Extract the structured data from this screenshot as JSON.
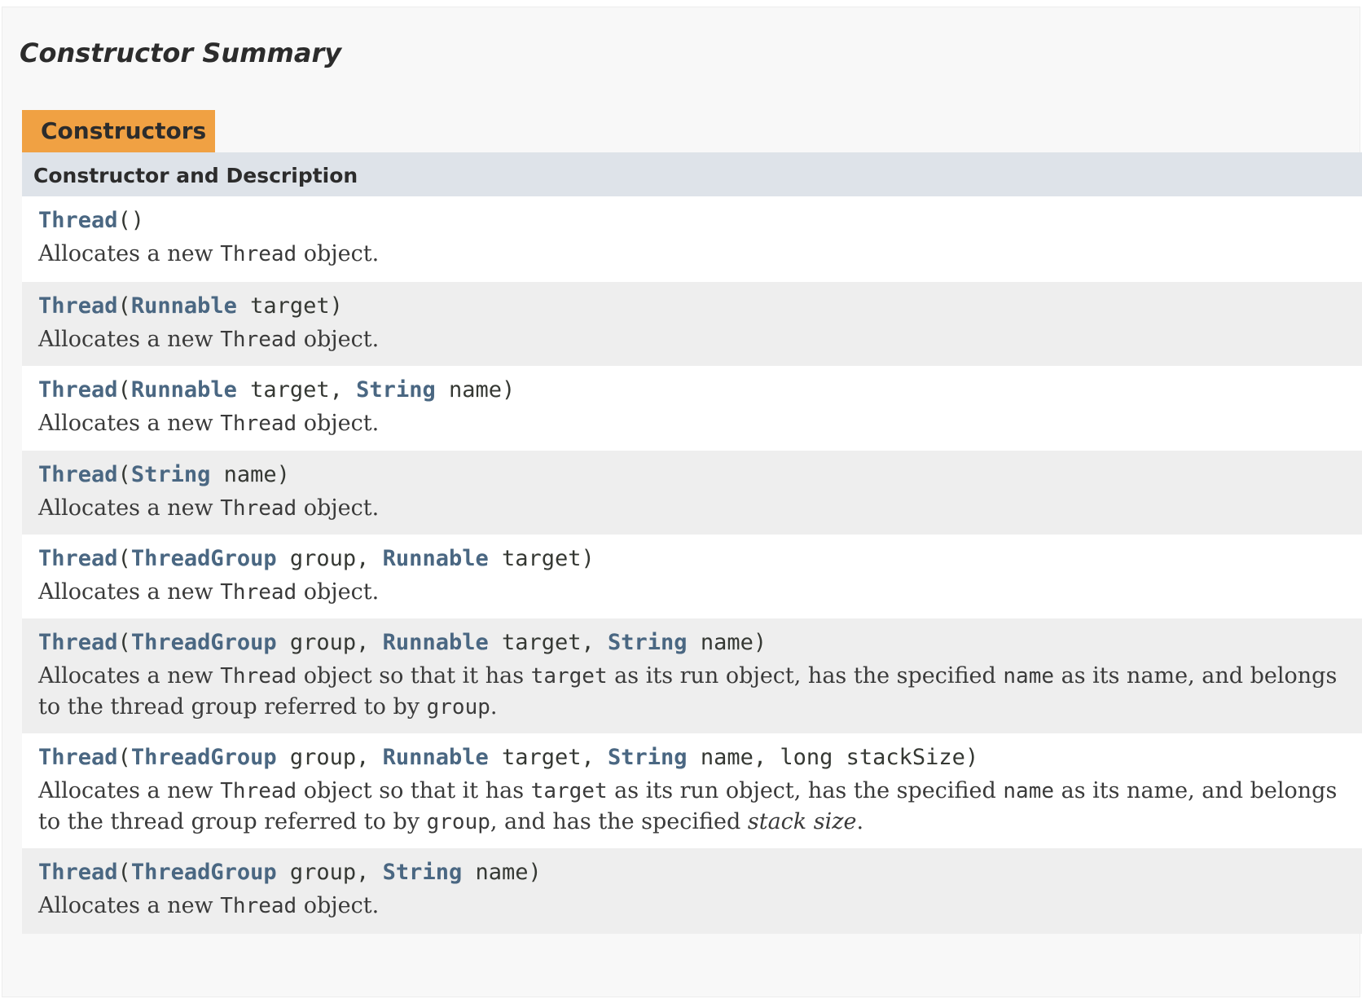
{
  "section": {
    "title": "Constructor Summary",
    "caption": "Constructors",
    "column_header": "Constructor and Description"
  },
  "constructors": [
    {
      "signature": [
        {
          "link": "Thread"
        },
        {
          "text": "()"
        }
      ],
      "description": [
        {
          "text": "Allocates a new "
        },
        {
          "code": "Thread"
        },
        {
          "text": " object."
        }
      ]
    },
    {
      "signature": [
        {
          "link": "Thread"
        },
        {
          "text": "("
        },
        {
          "link": "Runnable"
        },
        {
          "text": " target)"
        }
      ],
      "description": [
        {
          "text": "Allocates a new "
        },
        {
          "code": "Thread"
        },
        {
          "text": " object."
        }
      ]
    },
    {
      "signature": [
        {
          "link": "Thread"
        },
        {
          "text": "("
        },
        {
          "link": "Runnable"
        },
        {
          "text": " target, "
        },
        {
          "link": "String"
        },
        {
          "text": " name)"
        }
      ],
      "description": [
        {
          "text": "Allocates a new "
        },
        {
          "code": "Thread"
        },
        {
          "text": " object."
        }
      ]
    },
    {
      "signature": [
        {
          "link": "Thread"
        },
        {
          "text": "("
        },
        {
          "link": "String"
        },
        {
          "text": " name)"
        }
      ],
      "description": [
        {
          "text": "Allocates a new "
        },
        {
          "code": "Thread"
        },
        {
          "text": " object."
        }
      ]
    },
    {
      "signature": [
        {
          "link": "Thread"
        },
        {
          "text": "("
        },
        {
          "link": "ThreadGroup"
        },
        {
          "text": " group, "
        },
        {
          "link": "Runnable"
        },
        {
          "text": " target)"
        }
      ],
      "description": [
        {
          "text": "Allocates a new "
        },
        {
          "code": "Thread"
        },
        {
          "text": " object."
        }
      ]
    },
    {
      "signature": [
        {
          "link": "Thread"
        },
        {
          "text": "("
        },
        {
          "link": "ThreadGroup"
        },
        {
          "text": " group, "
        },
        {
          "link": "Runnable"
        },
        {
          "text": " target, "
        },
        {
          "link": "String"
        },
        {
          "text": " name)"
        }
      ],
      "description": [
        {
          "text": "Allocates a new "
        },
        {
          "code": "Thread"
        },
        {
          "text": " object so that it has "
        },
        {
          "code": "target"
        },
        {
          "text": " as its run object, has the specified "
        },
        {
          "code": "name"
        },
        {
          "text": " as its name, and belongs to the thread group referred to by "
        },
        {
          "code": "group"
        },
        {
          "text": "."
        }
      ]
    },
    {
      "signature": [
        {
          "link": "Thread"
        },
        {
          "text": "("
        },
        {
          "link": "ThreadGroup"
        },
        {
          "text": " group, "
        },
        {
          "link": "Runnable"
        },
        {
          "text": " target, "
        },
        {
          "link": "String"
        },
        {
          "text": " name, long stackSize)"
        }
      ],
      "description": [
        {
          "text": "Allocates a new "
        },
        {
          "code": "Thread"
        },
        {
          "text": " object so that it has "
        },
        {
          "code": "target"
        },
        {
          "text": " as its run object, has the specified "
        },
        {
          "code": "name"
        },
        {
          "text": " as its name, and belongs to the thread group referred to by "
        },
        {
          "code": "group"
        },
        {
          "text": ", and has the specified "
        },
        {
          "em": "stack size"
        },
        {
          "text": "."
        }
      ]
    },
    {
      "signature": [
        {
          "link": "Thread"
        },
        {
          "text": "("
        },
        {
          "link": "ThreadGroup"
        },
        {
          "text": " group, "
        },
        {
          "link": "String"
        },
        {
          "text": " name)"
        }
      ],
      "description": [
        {
          "text": "Allocates a new "
        },
        {
          "code": "Thread"
        },
        {
          "text": " object."
        }
      ]
    }
  ]
}
